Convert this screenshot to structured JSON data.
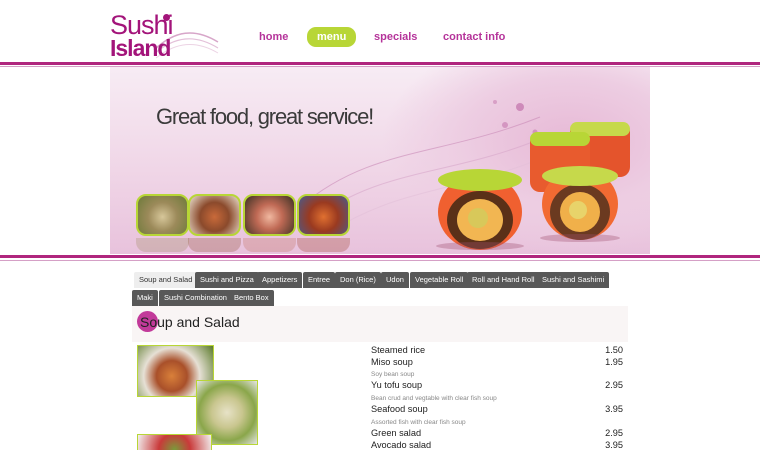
{
  "brand": {
    "line1": "Sushi",
    "line2": "Island",
    "color": "#a3147a"
  },
  "nav": {
    "items": [
      {
        "label": "home"
      },
      {
        "label": "menu",
        "active": true
      },
      {
        "label": "specials"
      },
      {
        "label": "contact info"
      }
    ],
    "active_color": "#b8d636",
    "link_color": "#b5339a"
  },
  "banner": {
    "tagline": "Great food, great service!"
  },
  "tabs": [
    {
      "label": "Soup and Salad",
      "active": true
    },
    {
      "label": "Sushi and Pizza"
    },
    {
      "label": "Appetizers"
    },
    {
      "label": "Entree"
    },
    {
      "label": "Don (Rice)"
    },
    {
      "label": "Udon"
    },
    {
      "label": "Vegetable Roll"
    },
    {
      "label": "Roll and Hand Roll"
    },
    {
      "label": "Sushi and Sashimi"
    },
    {
      "label": "Maki"
    },
    {
      "label": "Sushi Combination"
    },
    {
      "label": "Bento Box"
    }
  ],
  "section": {
    "title": "Soup and Salad"
  },
  "menu_items": [
    {
      "name": "Steamed rice",
      "price": "1.50",
      "description": ""
    },
    {
      "name": "Miso soup",
      "price": "1.95",
      "description": "Soy bean soup"
    },
    {
      "name": "Yu tofu soup",
      "price": "2.95",
      "description": "Bean crud and vegtable with clear fish soup"
    },
    {
      "name": "Seafood soup",
      "price": "3.95",
      "description": "Assorted fish with clear fish soup"
    },
    {
      "name": "Green salad",
      "price": "2.95",
      "description": ""
    },
    {
      "name": "Avocado salad",
      "price": "3.95",
      "description": ""
    }
  ],
  "colors": {
    "accent": "#b0267e",
    "tab_bg": "#585858",
    "lime": "#b8d636"
  }
}
